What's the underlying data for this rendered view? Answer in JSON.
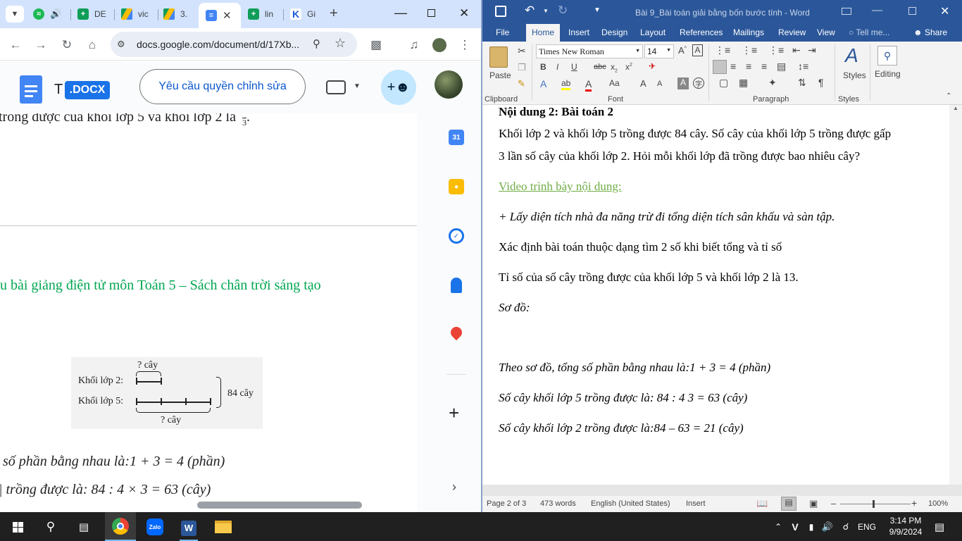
{
  "chrome": {
    "tabs": [
      {
        "label": "",
        "icon": "spotify-icon"
      },
      {
        "label": "DE",
        "icon": "sheets-icon"
      },
      {
        "label": "vic",
        "icon": "drive-icon"
      },
      {
        "label": "3.",
        "icon": "drive-icon"
      },
      {
        "label": "",
        "icon": "docs-icon",
        "active": true
      },
      {
        "label": "lin",
        "icon": "sheets-icon"
      },
      {
        "label": "Gi",
        "icon": "k-icon"
      }
    ],
    "new_tab": "+",
    "url": "docs.google.com/document/d/17Xb...",
    "docs": {
      "title_prefix": "T",
      "badge": ".DOCX",
      "request_edit": "Yêu cầu quyền chỉnh sửa"
    },
    "content": {
      "line_top": "trong được của khối lớp 5 và khối lớp 2 là",
      "fraction_den": "3",
      "heading": "u bài giảng điện tử môn Toán 5 – Sách chân trời sáng tạo",
      "diagram": {
        "top_label": "? cây",
        "row1": "Khối lớp 2:",
        "row2": "Khối lớp 5:",
        "total": "84 cây",
        "bottom_label": "? cây"
      },
      "line_a": "số phần bằng nhau là:1 + 3 = 4 (phần)",
      "line_b": "trồng được là: 84 : 4  × 3 = 63 (cây)"
    },
    "rail": {
      "calendar_day": "31"
    }
  },
  "word": {
    "title": "Bài 9_Bài toán giải bằng bốn bước tính  -  Word",
    "menu": [
      "File",
      "Home",
      "Insert",
      "Design",
      "Layout",
      "References",
      "Mailings",
      "Review",
      "View"
    ],
    "tell_me": "Tell me...",
    "share": "Share",
    "ribbon": {
      "paste": "Paste",
      "font_name": "Times New Roman",
      "font_size": "14",
      "styles": "Styles",
      "editing": "Editing",
      "groups": [
        "Clipboard",
        "Font",
        "Paragraph",
        "Styles"
      ]
    },
    "doc": {
      "heading": "Nội dung 2: Bài toán 2",
      "p1": "Khối lớp 2 và khối lớp 5 trồng được 84 cây. Số cây của khối lớp 5 trồng được gấp",
      "p2": "3 lần số cây của khối lớp 2. Hỏi mỗi khối lớp đã trồng được bao nhiêu cây?",
      "link": "Video trình bày nội dung:",
      "p3": "+ Lấy diện tích nhà đa năng trừ đi tổng diện tích sân khấu và sàn tập.",
      "p4": "Xác định bài toán thuộc dạng tìm 2 số khi biết tổng và tỉ số",
      "p5": "Tỉ số của số cây trồng được của khối lớp 5 và khối lớp 2 là 13.",
      "p6": "Sơ đồ:",
      "p7": "Theo sơ đồ, tổng số phần bằng nhau là:1 + 3 = 4 (phần)",
      "p8": "Số cây khối lớp 5 trồng được là: 84 : 4   3 = 63 (cây)",
      "p9": "Số cây khối lớp 2 trồng được là:84 – 63 = 21 (cây)"
    },
    "status": {
      "page": "Page 2 of 3",
      "words": "473 words",
      "lang": "English (United States)",
      "mode": "Insert",
      "zoom": "100%"
    }
  },
  "taskbar": {
    "lang": "ENG",
    "time": "3:14 PM",
    "date": "9/9/2024"
  },
  "colors": {
    "chrome_tabbar": "#d3e3fd",
    "word_blue": "#2b579a",
    "docs_heading_green": "#00a650",
    "link_green": "#70ad47"
  }
}
